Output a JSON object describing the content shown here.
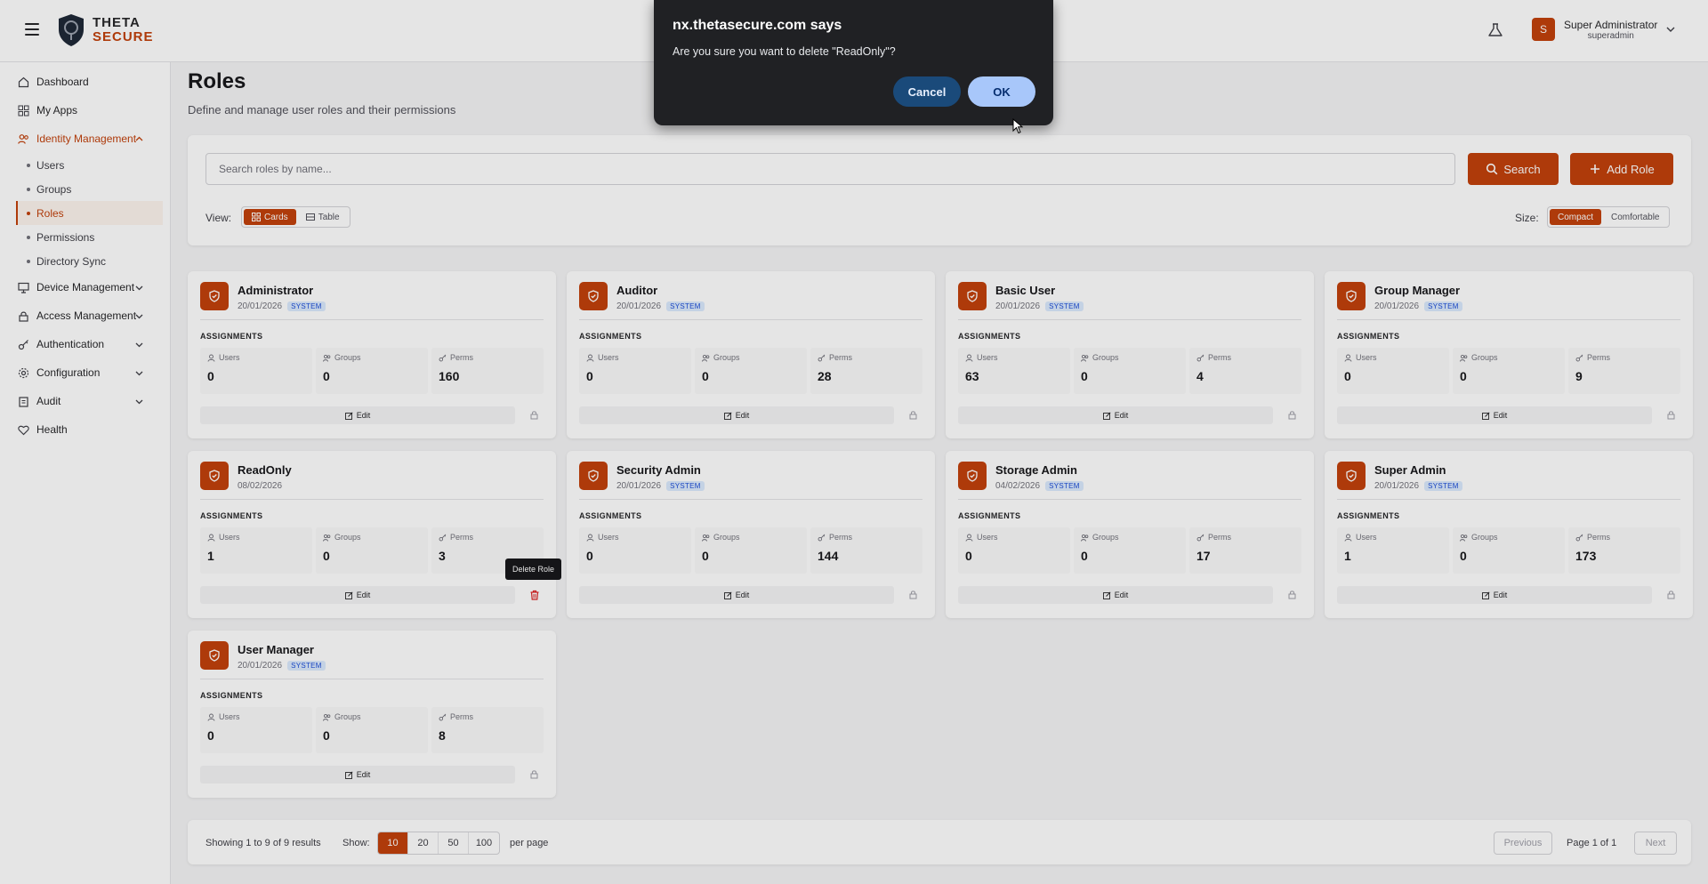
{
  "header": {
    "logo_line1": "THETA",
    "logo_line2": "SECURE",
    "user_initial": "S",
    "user_name": "Super Administrator",
    "user_login": "superadmin"
  },
  "sidebar": {
    "items": [
      {
        "label": "Dashboard"
      },
      {
        "label": "My Apps"
      },
      {
        "label": "Identity Management"
      },
      {
        "label": "Users"
      },
      {
        "label": "Groups"
      },
      {
        "label": "Roles"
      },
      {
        "label": "Permissions"
      },
      {
        "label": "Directory Sync"
      },
      {
        "label": "Device Management"
      },
      {
        "label": "Access Management"
      },
      {
        "label": "Authentication"
      },
      {
        "label": "Configuration"
      },
      {
        "label": "Audit"
      },
      {
        "label": "Health"
      }
    ]
  },
  "page": {
    "title": "Roles",
    "subtitle": "Define and manage user roles and their permissions"
  },
  "toolbar": {
    "search_placeholder": "Search roles by name...",
    "search_label": "Search",
    "add_label": "Add Role",
    "view_label": "View:",
    "view_cards": "Cards",
    "view_table": "Table",
    "size_label": "Size:",
    "size_compact": "Compact",
    "size_comfortable": "Comfortable"
  },
  "card_labels": {
    "assignments": "ASSIGNMENTS",
    "users": "Users",
    "groups": "Groups",
    "perms": "Perms",
    "edit": "Edit",
    "system": "SYSTEM"
  },
  "roles": [
    {
      "name": "Administrator",
      "date": "20/01/2026",
      "system": true,
      "users": "0",
      "groups": "0",
      "perms": "160"
    },
    {
      "name": "Auditor",
      "date": "20/01/2026",
      "system": true,
      "users": "0",
      "groups": "0",
      "perms": "28"
    },
    {
      "name": "Basic User",
      "date": "20/01/2026",
      "system": true,
      "users": "63",
      "groups": "0",
      "perms": "4"
    },
    {
      "name": "Group Manager",
      "date": "20/01/2026",
      "system": true,
      "users": "0",
      "groups": "0",
      "perms": "9"
    },
    {
      "name": "ReadOnly",
      "date": "08/02/2026",
      "system": false,
      "users": "1",
      "groups": "0",
      "perms": "3"
    },
    {
      "name": "Security Admin",
      "date": "20/01/2026",
      "system": true,
      "users": "0",
      "groups": "0",
      "perms": "144"
    },
    {
      "name": "Storage Admin",
      "date": "04/02/2026",
      "system": true,
      "users": "0",
      "groups": "0",
      "perms": "17"
    },
    {
      "name": "Super Admin",
      "date": "20/01/2026",
      "system": true,
      "users": "1",
      "groups": "0",
      "perms": "173"
    },
    {
      "name": "User Manager",
      "date": "20/01/2026",
      "system": true,
      "users": "0",
      "groups": "0",
      "perms": "8"
    }
  ],
  "tooltip": "Delete Role",
  "pagination": {
    "summary": "Showing 1 to 9 of 9 results",
    "show_label": "Show:",
    "sizes": [
      "10",
      "20",
      "50",
      "100"
    ],
    "per_page": "per page",
    "previous": "Previous",
    "page_info": "Page 1 of 1",
    "next": "Next"
  },
  "dialog": {
    "title": "nx.thetasecure.com says",
    "message": "Are you sure you want to delete \"ReadOnly\"?",
    "cancel": "Cancel",
    "ok": "OK"
  },
  "colors": {
    "accent": "#c2410c",
    "dialog_bg": "#202124",
    "ok_button": "#a8c7fa",
    "cancel_button": "#1a4a7a"
  }
}
